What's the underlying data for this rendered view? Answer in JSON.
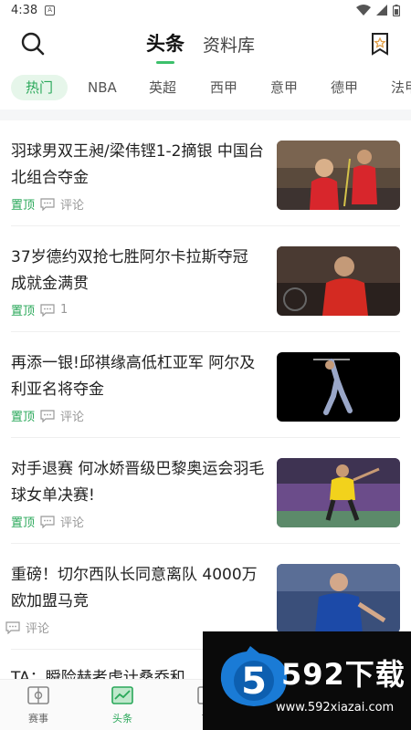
{
  "status_bar": {
    "time": "4:38",
    "badge": "A"
  },
  "header": {
    "tabs": [
      {
        "label": "头条",
        "active": true
      },
      {
        "label": "资料库",
        "active": false
      }
    ]
  },
  "categories": [
    {
      "label": "热门",
      "active": true
    },
    {
      "label": "NBA"
    },
    {
      "label": "英超"
    },
    {
      "label": "西甲"
    },
    {
      "label": "意甲"
    },
    {
      "label": "德甲"
    },
    {
      "label": "法甲"
    }
  ],
  "news": [
    {
      "title": "羽球男双王昶/梁伟铿1-2摘银 中国台北组合夺金",
      "pinned": "置顶",
      "comment": "评论"
    },
    {
      "title": "37岁德约双抢七胜阿尔卡拉斯夺冠 成就金满贯",
      "pinned": "置顶",
      "comment": "1"
    },
    {
      "title": "再添一银!邱祺缘高低杠亚军 阿尔及利亚名将夺金",
      "pinned": "置顶",
      "comment": "评论"
    },
    {
      "title": "对手退赛 何冰娇晋级巴黎奥运会羽毛球女单决赛!",
      "pinned": "置顶",
      "comment": "评论"
    },
    {
      "title": "重磅！切尔西队长同意离队 4000万欧加盟马竞",
      "pinned": "",
      "comment": "评论"
    }
  ],
  "partial_item": {
    "title": "TA：瞬险赫者虑计桑乔和"
  },
  "bottom_nav": [
    {
      "label": "赛事",
      "active": false
    },
    {
      "label": "头条",
      "active": true
    },
    {
      "label": "首",
      "active": false
    }
  ],
  "watermark": {
    "brand": "592下载",
    "url": "www.592xiazai.com",
    "logo_digit": "5"
  },
  "colors": {
    "accent": "#2aa85a",
    "accent_light": "#e6f6ea"
  }
}
